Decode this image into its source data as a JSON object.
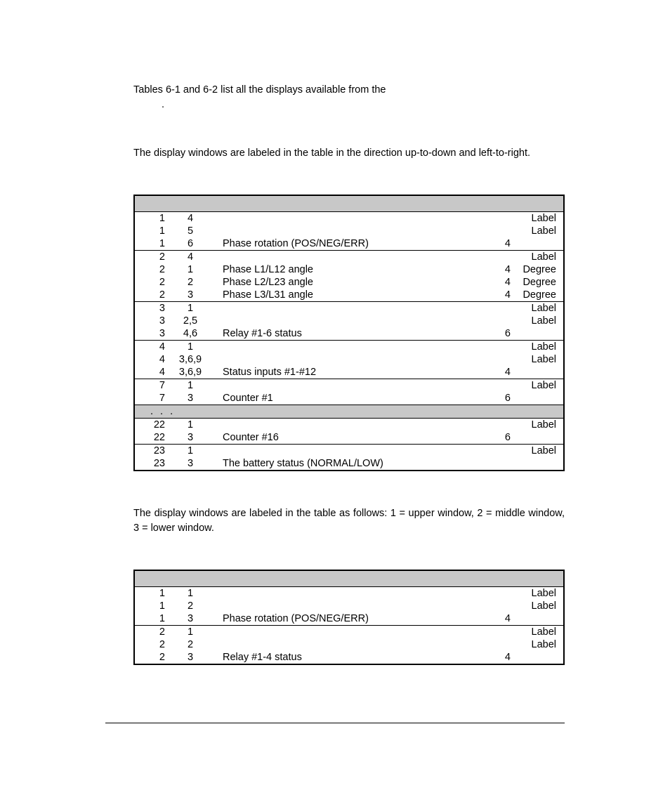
{
  "para1": "Tables 6-1 and 6-2 list all the displays available from the",
  "dot": ".",
  "para2": "The display windows are labeled in the table in the direction up-to-down and left-to-right.",
  "para3": "The display windows are labeled in the table as follows: 1 = upper window, 2 = middle window, 3 = lower window.",
  "table1_ellipsis": ". . .",
  "table1": [
    [
      {
        "p": "1",
        "w": "4",
        "d": "",
        "n": "",
        "u": "Label",
        "sep": true
      },
      {
        "p": "1",
        "w": "5",
        "d": "",
        "n": "",
        "u": "Label"
      },
      {
        "p": "1",
        "w": "6",
        "d": "Phase rotation (POS/NEG/ERR)",
        "n": "4",
        "u": ""
      }
    ],
    [
      {
        "p": "2",
        "w": "4",
        "d": "",
        "n": "",
        "u": "Label",
        "sep": true
      },
      {
        "p": "2",
        "w": "1",
        "d": "Phase L1/L12 angle",
        "n": "4",
        "u": "Degree"
      },
      {
        "p": "2",
        "w": "2",
        "d": "Phase L2/L23 angle",
        "n": "4",
        "u": "Degree"
      },
      {
        "p": "2",
        "w": "3",
        "d": "Phase L3/L31 angle",
        "n": "4",
        "u": "Degree"
      }
    ],
    [
      {
        "p": "3",
        "w": "1",
        "d": "",
        "n": "",
        "u": "Label",
        "sep": true
      },
      {
        "p": "3",
        "w": "2,5",
        "d": "",
        "n": "",
        "u": "Label"
      },
      {
        "p": "3",
        "w": "4,6",
        "d": "Relay #1-6 status",
        "n": "6",
        "u": ""
      }
    ],
    [
      {
        "p": "4",
        "w": "1",
        "d": "",
        "n": "",
        "u": "Label",
        "sep": true
      },
      {
        "p": "4",
        "w": "3,6,9",
        "d": "",
        "n": "",
        "u": "Label"
      },
      {
        "p": "4",
        "w": "3,6,9",
        "d": "Status inputs #1-#12",
        "n": "4",
        "u": ""
      }
    ],
    [
      {
        "p": "7",
        "w": "1",
        "d": "",
        "n": "",
        "u": "Label",
        "sep": true
      },
      {
        "p": "7",
        "w": "3",
        "d": "Counter #1",
        "n": "6",
        "u": ""
      }
    ]
  ],
  "table1_post": [
    [
      {
        "p": "22",
        "w": "1",
        "d": "",
        "n": "",
        "u": "Label",
        "sep": true
      },
      {
        "p": "22",
        "w": "3",
        "d": "Counter #16",
        "n": "6",
        "u": ""
      }
    ],
    [
      {
        "p": "23",
        "w": "1",
        "d": "",
        "n": "",
        "u": "Label",
        "sep": true
      },
      {
        "p": "23",
        "w": "3",
        "d": "The battery status (NORMAL/LOW)",
        "n": "",
        "u": ""
      }
    ]
  ],
  "table2": [
    [
      {
        "p": "1",
        "w": "1",
        "d": "",
        "n": "",
        "u": "Label",
        "sep": true
      },
      {
        "p": "1",
        "w": "2",
        "d": "",
        "n": "",
        "u": "Label"
      },
      {
        "p": "1",
        "w": "3",
        "d": "Phase rotation (POS/NEG/ERR)",
        "n": "4",
        "u": ""
      }
    ],
    [
      {
        "p": "2",
        "w": "1",
        "d": "",
        "n": "",
        "u": "Label",
        "sep": true
      },
      {
        "p": "2",
        "w": "2",
        "d": "",
        "n": "",
        "u": "Label"
      },
      {
        "p": "2",
        "w": "3",
        "d": "Relay #1-4 status",
        "n": "4",
        "u": ""
      }
    ]
  ]
}
